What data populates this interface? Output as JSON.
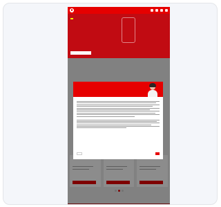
{
  "hero": {
    "badge": "",
    "headline": "",
    "subline": "",
    "price": "",
    "note": "",
    "cta": ""
  },
  "section": {
    "title": "",
    "subtitle": ""
  },
  "cookie_modal": {
    "title": "",
    "heading": "",
    "decline_label": "",
    "accept_label": ""
  },
  "tariffs": [
    {
      "price": ""
    },
    {
      "price": ""
    },
    {
      "price": ""
    }
  ],
  "footer": {
    "text": ""
  },
  "carousel": {
    "pages": 3,
    "active": 1
  },
  "colors": {
    "brand_red": "#e60000",
    "hero_red": "#c10b12",
    "badge_yellow": "#f6e800"
  }
}
